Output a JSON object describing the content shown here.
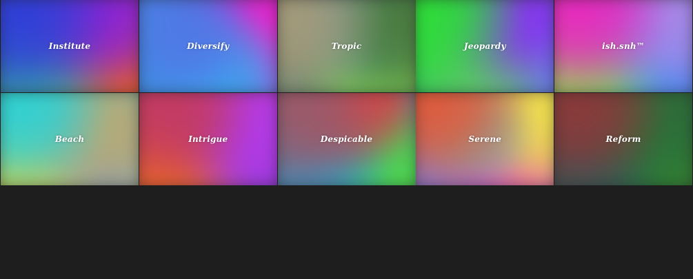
{
  "tiles": [
    {
      "label": "Institute",
      "colors": [
        "#2f3ed8",
        "#8a22d6",
        "#33b2a0",
        "#e8621e",
        "#c427b8"
      ]
    },
    {
      "label": "Diversify",
      "colors": [
        "#4f79e6",
        "#3aa6ef",
        "#f222c8",
        "#7b3ad8",
        "#3f8ee0"
      ]
    },
    {
      "label": "Tropic",
      "colors": [
        "#a49a7a",
        "#4a7a3a",
        "#3fa1df",
        "#7fd158",
        "#5a7f70"
      ]
    },
    {
      "label": "Jeopardy",
      "colors": [
        "#2fdc3a",
        "#8a2cf2",
        "#62c36c",
        "#6b7be8",
        "#3aa58e"
      ]
    },
    {
      "label": "ish.snh™",
      "colors": [
        "#e828c0",
        "#a68ae8",
        "#8fe64a",
        "#2a8ef0",
        "#5a64e6"
      ]
    },
    {
      "label": "Beach",
      "colors": [
        "#2fd0d4",
        "#b8aa74",
        "#e8d43a",
        "#6a8ed8",
        "#9aa6a0"
      ]
    },
    {
      "label": "Intrigue",
      "colors": [
        "#c23a62",
        "#b43ae6",
        "#ee6a22",
        "#7a3ad8",
        "#c83ab8"
      ]
    },
    {
      "label": "Despicable",
      "colors": [
        "#9a5a6a",
        "#e83a3a",
        "#2a9ad0",
        "#4ed84a",
        "#4a86a8"
      ]
    },
    {
      "label": "Serene",
      "colors": [
        "#e05a3a",
        "#80a8a2",
        "#f2e24a",
        "#e834c8",
        "#7a7ae6"
      ]
    },
    {
      "label": "Reform",
      "colors": [
        "#8a3a3a",
        "#2a6e3a",
        "#2a5a5a",
        "#2e8e2e",
        "#5a3a3a"
      ]
    }
  ]
}
